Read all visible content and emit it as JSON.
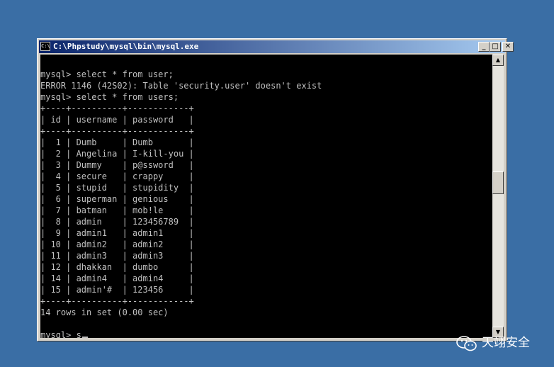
{
  "window": {
    "title": "C:\\Phpstudy\\mysql\\bin\\mysql.exe",
    "icon_label": "C:\\",
    "buttons": {
      "minimize": "_",
      "maximize": "□",
      "close": "✕"
    }
  },
  "console": {
    "lines": [
      "",
      "mysql> select * from user;",
      "ERROR 1146 (42S02): Table 'security.user' doesn't exist",
      "mysql> select * from users;",
      "+----+----------+------------+",
      "| id | username | password   |",
      "+----+----------+------------+",
      "|  1 | Dumb     | Dumb       |",
      "|  2 | Angelina | I-kill-you |",
      "|  3 | Dummy    | p@ssword   |",
      "|  4 | secure   | crappy     |",
      "|  5 | stupid   | stupidity  |",
      "|  6 | superman | genious    |",
      "|  7 | batman   | mob!le     |",
      "|  8 | admin    | 123456789  |",
      "|  9 | admin1   | admin1     |",
      "| 10 | admin2   | admin2     |",
      "| 11 | admin3   | admin3     |",
      "| 12 | dhakkan  | dumbo      |",
      "| 14 | admin4   | admin4     |",
      "| 15 | admin'#  | 123456     |",
      "+----+----------+------------+",
      "14 rows in set (0.00 sec)",
      "",
      "mysql> s"
    ]
  },
  "scrollbar": {
    "up_arrow": "▲",
    "down_arrow": "▼"
  },
  "watermark": {
    "text": "天翊安全",
    "icon": "wechat-icon"
  },
  "colors": {
    "desktop": "#3a6ea5",
    "console_bg": "#000000",
    "console_fg": "#c0c0c0",
    "titlebar": "#0a246a"
  }
}
